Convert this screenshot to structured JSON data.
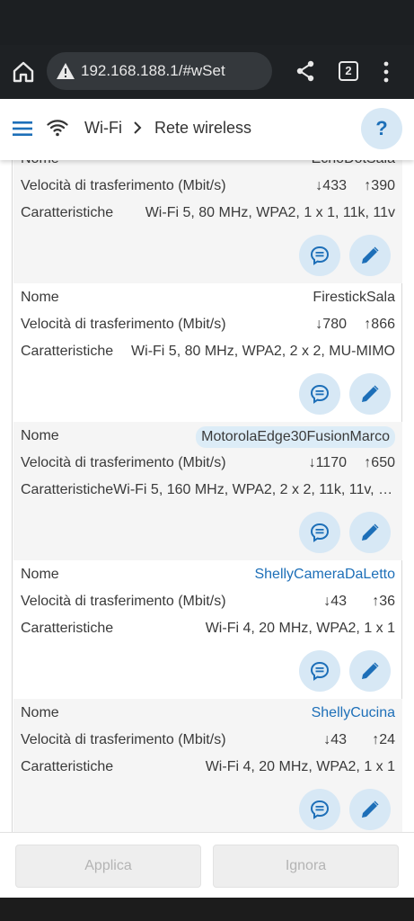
{
  "browser": {
    "url": "192.168.188.1/#wSet",
    "tab_count": "2"
  },
  "header": {
    "breadcrumb_root": "Wi-Fi",
    "breadcrumb_current": "Rete wireless",
    "help_label": "?"
  },
  "labels": {
    "name": "Nome",
    "speed": "Velocità di trasferimento (Mbit/s)",
    "features": "Caratteristiche"
  },
  "devices": [
    {
      "name": "EchoDotSala",
      "down": "↓433",
      "up": "↑390",
      "features": "Wi-Fi 5, 80 MHz, WPA2, 1 x 1, 11k, 11v"
    },
    {
      "name": "FirestickSala",
      "down": "↓780",
      "up": "↑866",
      "features": "Wi-Fi 5, 80 MHz, WPA2, 2 x 2, MU-MIMO"
    },
    {
      "name": "MotorolaEdge30FusionMarco",
      "down": "↓1170",
      "up": "↑650",
      "features": "Wi-Fi 5, 160 MHz, WPA2, 2 x 2, 11k, 11v, M..."
    },
    {
      "name": "ShellyCameraDaLetto",
      "down": "↓43",
      "up": "↑36",
      "features": "Wi-Fi 4, 20 MHz, WPA2, 1 x 1"
    },
    {
      "name": "ShellyCucina",
      "down": "↓43",
      "up": "↑24",
      "features": "Wi-Fi 4, 20 MHz, WPA2, 1 x 1"
    }
  ],
  "footer": {
    "apply_label": "Applica",
    "ignore_label": "Ignora"
  },
  "colors": {
    "accent": "#1d6fb8",
    "button_bg": "#d7e8f5",
    "row_shade": "#f5f5f5"
  },
  "icons": [
    "home-icon",
    "warning-icon",
    "share-icon",
    "tabs-icon",
    "more-vert-icon",
    "hamburger-icon",
    "wifi-icon",
    "chevron-right-icon",
    "help-icon",
    "details-icon",
    "edit-icon"
  ]
}
